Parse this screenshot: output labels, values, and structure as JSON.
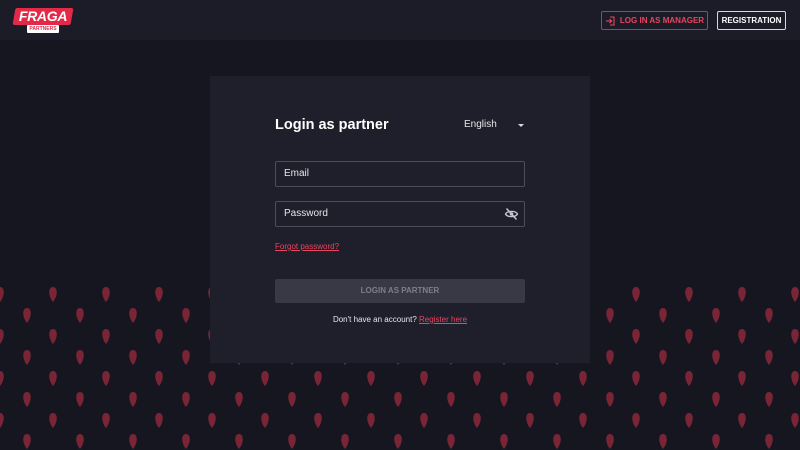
{
  "header": {
    "logo_text": "FRAGA",
    "logo_sub": "PARTNERS",
    "manager_label": "LOG IN AS MANAGER",
    "registration_label": "REGISTRATION"
  },
  "login": {
    "title": "Login as partner",
    "language": "English",
    "email_placeholder": "Email",
    "password_placeholder": "Password",
    "forgot_label": "Forgot password?",
    "submit_label": "LOGIN AS PARTNER",
    "no_account_text": "Don't have an account?",
    "register_label": "Register here"
  },
  "colors": {
    "accent": "#e22a48",
    "background": "#151620",
    "card": "#1e1f2b",
    "pattern_drop": "#7a2536"
  },
  "icons": {
    "manager_button_icon": "login-arrow-icon",
    "password_toggle_icon": "eye-off-icon",
    "language_dropdown_icon": "caret-down-icon"
  }
}
